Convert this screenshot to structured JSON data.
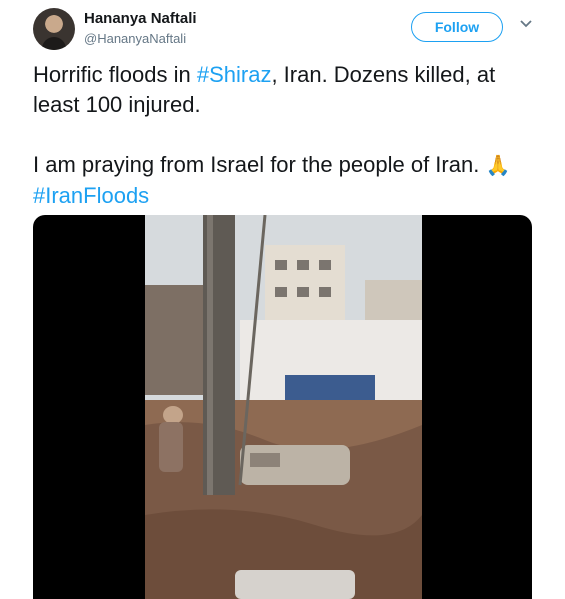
{
  "user": {
    "name": "Hananya Naftali",
    "handle": "@HananyaNaftali"
  },
  "follow_label": "Follow",
  "tweet": {
    "line1_prefix": "Horrific floods in ",
    "hashtag1": "#Shiraz",
    "line1_suffix": ", Iran. Dozens killed, at least 100 injured.",
    "line2_prefix": "I am praying from Israel for the people of Iran. ",
    "emoji": "🙏",
    "hashtag2": "#IranFloods"
  },
  "colors": {
    "accent": "#1da1f2",
    "text": "#14171a",
    "muted": "#657786"
  }
}
